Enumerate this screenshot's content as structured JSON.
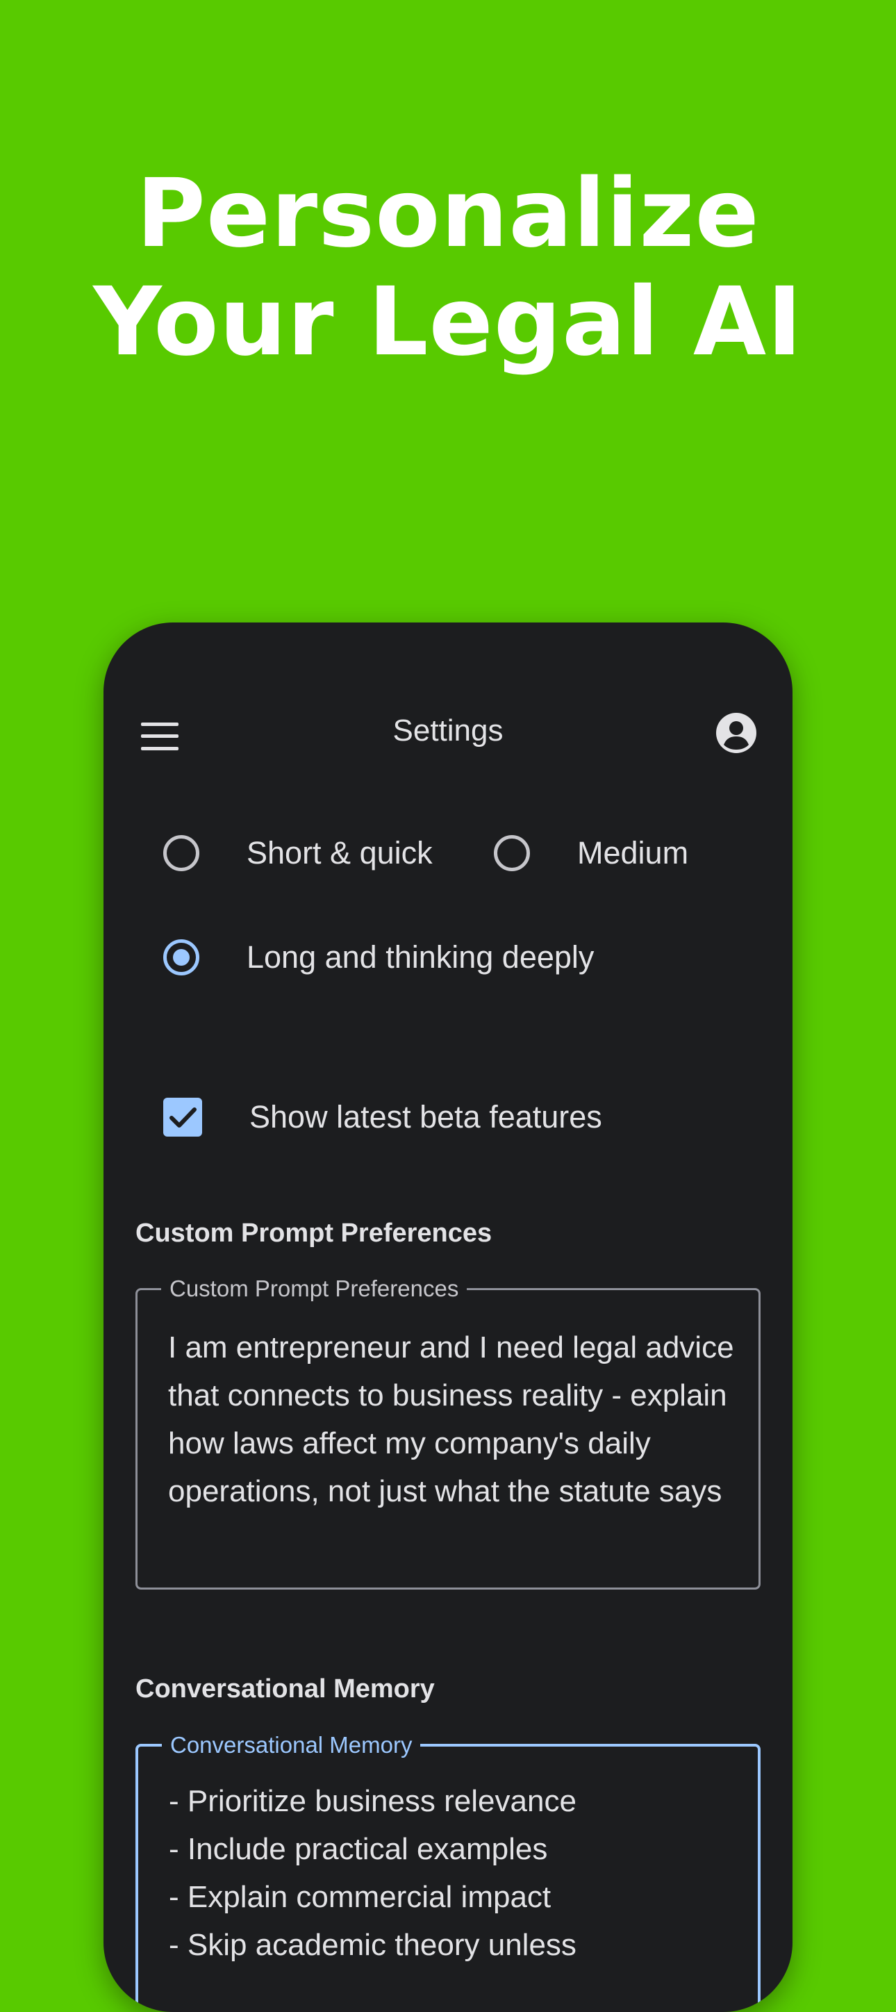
{
  "headline": {
    "line1": "Personalize",
    "line2": "Your Legal AI"
  },
  "topbar": {
    "title": "Settings",
    "menu_icon": "menu-icon",
    "account_icon": "account-circle-icon"
  },
  "response_length": {
    "options": [
      {
        "label": "Short & quick",
        "selected": false
      },
      {
        "label": "Medium",
        "selected": false
      },
      {
        "label": "Long and thinking deeply",
        "selected": true
      }
    ]
  },
  "beta": {
    "label": "Show latest beta features",
    "checked": true
  },
  "custom_prompt": {
    "section_title": "Custom Prompt Preferences",
    "field_label": "Custom Prompt Preferences",
    "value": "I am entrepreneur and I  need legal advice that connects to business reality - explain how laws affect my company's daily operations, not just what the statute says"
  },
  "memory": {
    "section_title": "Conversational Memory",
    "field_label": "Conversational Memory",
    "value": "- Prioritize business relevance\n- Include practical examples\n- Explain commercial impact\n- Skip academic theory unless"
  },
  "colors": {
    "background": "#58CA00",
    "surface": "#1c1d1f",
    "accent": "#9cc8ff",
    "text": "#e3e3e6"
  }
}
